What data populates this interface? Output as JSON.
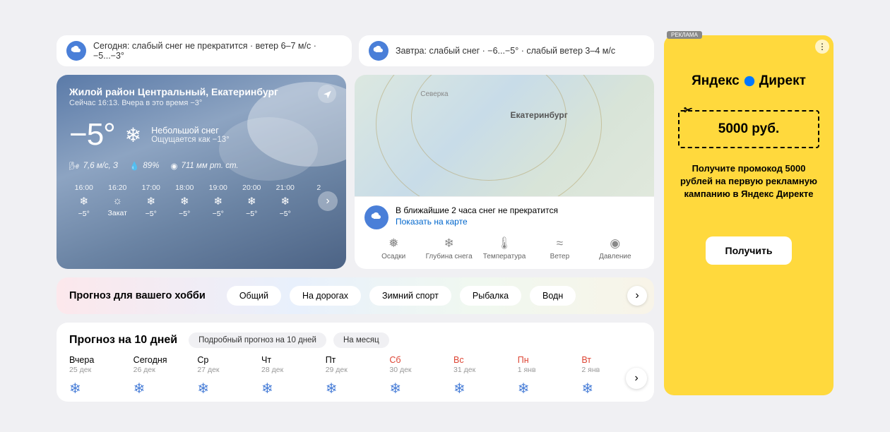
{
  "strip": {
    "today": "Сегодня: слабый снег не прекратится · ветер 6–7 м/с · −5...−3°",
    "tomorrow": "Завтра: слабый снег · −6...−5° · слабый ветер 3–4 м/с"
  },
  "current": {
    "location": "Жилой район Центральный, Екатеринбург",
    "subline": "Сейчас 16:13. Вчера в это время −3°",
    "temp": "−5°",
    "condition": "Небольшой снег",
    "feels": "Ощущается как −13°",
    "wind": "7,6 м/с, З",
    "humidity": "89%",
    "pressure": "711 мм рт. ст."
  },
  "hourly": [
    {
      "time": "16:00",
      "icon": "❄",
      "val": "−5°"
    },
    {
      "time": "16:20",
      "icon": "☼",
      "val": "Закат"
    },
    {
      "time": "17:00",
      "icon": "❄",
      "val": "−5°"
    },
    {
      "time": "18:00",
      "icon": "❄",
      "val": "−5°"
    },
    {
      "time": "19:00",
      "icon": "❄",
      "val": "−5°"
    },
    {
      "time": "20:00",
      "icon": "❄",
      "val": "−5°"
    },
    {
      "time": "21:00",
      "icon": "❄",
      "val": "−5°"
    },
    {
      "time": "2",
      "icon": "",
      "val": ""
    }
  ],
  "map": {
    "city": "Екатеринбург",
    "town": "Северка",
    "info": "В ближайшие 2 часа снег не прекратится",
    "show_link": "Показать на карте",
    "layers": [
      "Осадки",
      "Глубина снега",
      "Температура",
      "Ветер",
      "Давление"
    ]
  },
  "hobby": {
    "title": "Прогноз для вашего хобби",
    "tabs": [
      "Общий",
      "На дорогах",
      "Зимний спорт",
      "Рыбалка",
      "Водн"
    ]
  },
  "forecast": {
    "title": "Прогноз на 10 дней",
    "chips": [
      "Подробный прогноз на 10 дней",
      "На месяц"
    ],
    "days": [
      {
        "name": "Вчера",
        "date": "25 дек",
        "weekend": false
      },
      {
        "name": "Сегодня",
        "date": "26 дек",
        "weekend": false
      },
      {
        "name": "Ср",
        "date": "27 дек",
        "weekend": false
      },
      {
        "name": "Чт",
        "date": "28 дек",
        "weekend": false
      },
      {
        "name": "Пт",
        "date": "29 дек",
        "weekend": false
      },
      {
        "name": "Сб",
        "date": "30 дек",
        "weekend": true
      },
      {
        "name": "Вс",
        "date": "31 дек",
        "weekend": true
      },
      {
        "name": "Пн",
        "date": "1 янв",
        "weekend": true
      },
      {
        "name": "Вт",
        "date": "2 янв",
        "weekend": true
      }
    ]
  },
  "ad": {
    "tag": "РЕКЛАМА",
    "brand1": "Яндекс",
    "brand2": "Директ",
    "coupon": "5000 руб.",
    "text": "Получите промокод 5000 рублей на первую рекламную кампанию в Яндекс Директе",
    "button": "Получить"
  },
  "layer_icons": [
    "❅",
    "❄",
    "🌡",
    "≈",
    "◉"
  ]
}
